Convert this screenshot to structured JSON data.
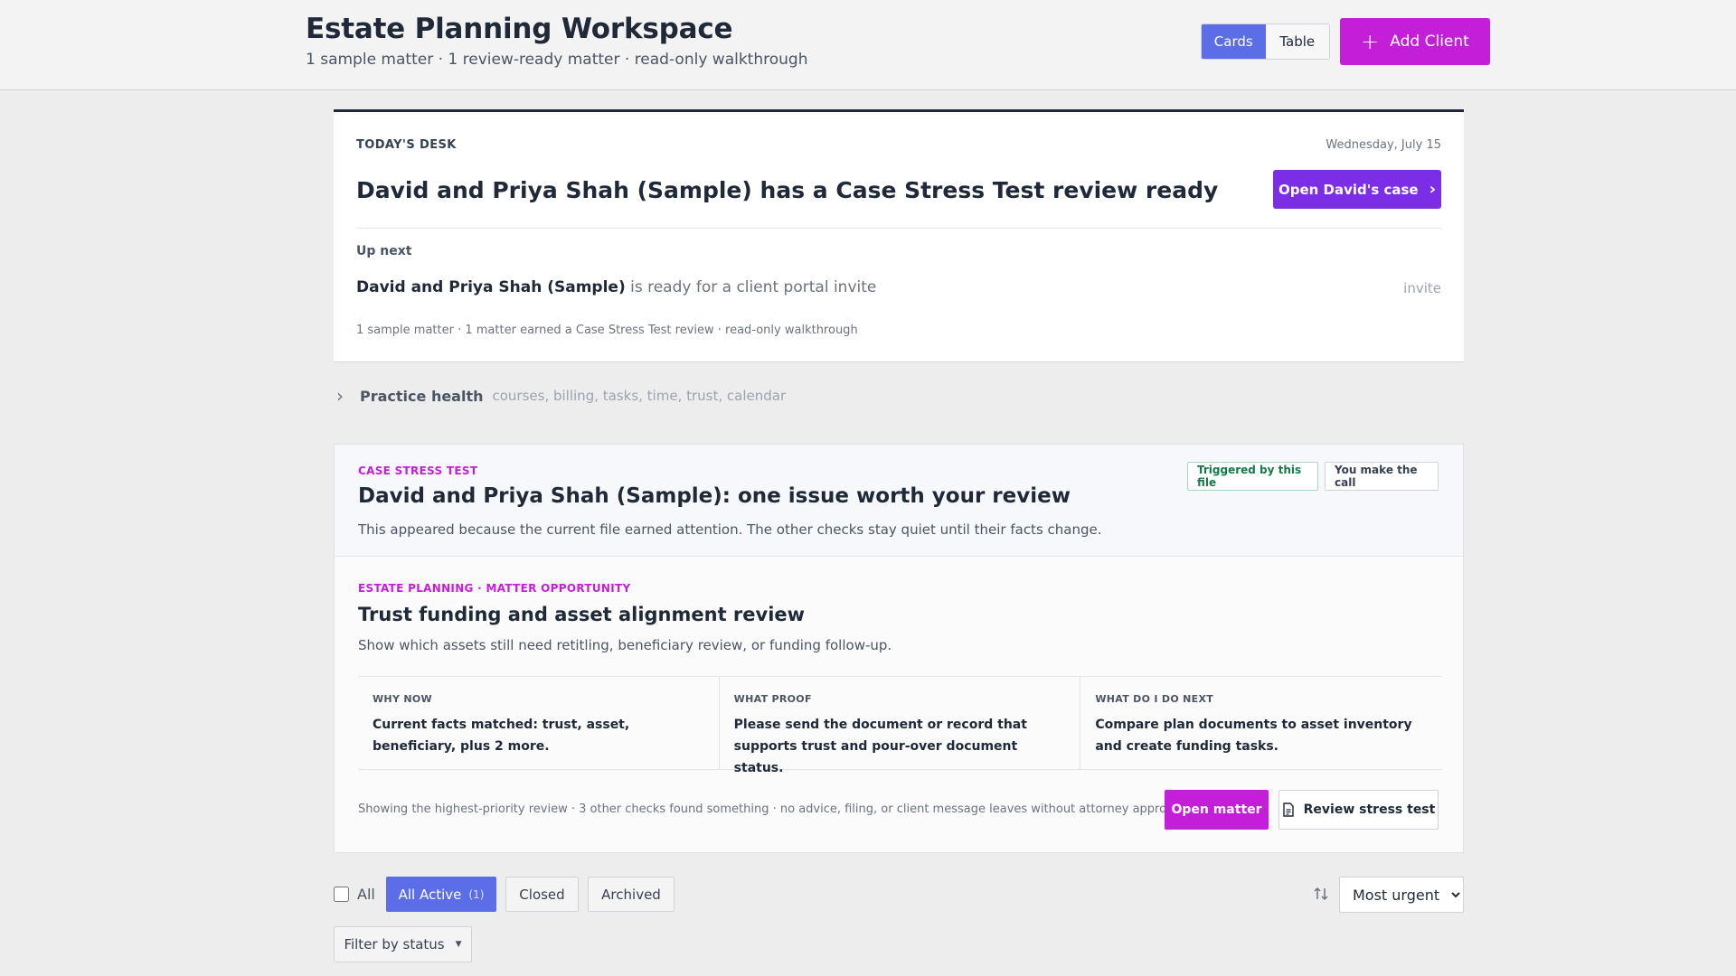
{
  "header": {
    "title": "Estate Planning Workspace",
    "subtitle": "1 sample matter · 1 review-ready matter · read-only walkthrough",
    "view_cards": "Cards",
    "view_table": "Table",
    "add_client": "Add Client"
  },
  "desk": {
    "eyebrow": "TODAY'S DESK",
    "date": "Wednesday, July 15",
    "headline": "David and Priya Shah (Sample) has a Case Stress Test review ready",
    "open_case": "Open David's case",
    "upnext_label": "Up next",
    "upnext_client": "David and Priya Shah (Sample)",
    "upnext_text": "is ready for a client portal invite",
    "upnext_tag": "invite",
    "meta": "1 sample matter · 1 matter earned a Case Stress Test review · read-only walkthrough"
  },
  "practice_health": {
    "label": "Practice health",
    "sub": "courses, billing, tasks, time, trust, calendar"
  },
  "stress_test": {
    "eyebrow": "CASE STRESS TEST",
    "title": "David and Priya Shah (Sample): one issue worth your review",
    "description": "This appeared because the current file earned attention. The other checks stay quiet until their facts change.",
    "pill_triggered": "Triggered by this file",
    "pill_call": "You make the call",
    "opportunity": {
      "eyebrow": "ESTATE PLANNING · MATTER OPPORTUNITY",
      "title": "Trust funding and asset alignment review",
      "description": "Show which assets still need retitling, beneficiary review, or funding follow-up.",
      "facts": [
        {
          "label": "WHY NOW",
          "text": "Current facts matched: trust, asset, beneficiary, plus 2 more."
        },
        {
          "label": "WHAT PROOF",
          "text": "Please send the document or record that supports trust and pour-over document status."
        },
        {
          "label": "WHAT DO I DO NEXT",
          "text": "Compare plan documents to asset inventory and create funding tasks."
        }
      ]
    },
    "footnote": "Showing the highest-priority review · 3 other checks found something · no advice, filing, or client message leaves without attorney approval.",
    "open_matter": "Open matter",
    "review_stress": "Review stress test"
  },
  "filters": {
    "select_all": "All",
    "tab_active": "All Active",
    "tab_active_count": "(1)",
    "tab_closed": "Closed",
    "tab_archived": "Archived",
    "sort_selected": "Most urgent",
    "filter_status": "Filter by status"
  },
  "colors": {
    "accent_magenta": "#c41fd8",
    "accent_purple": "#7c2ee6",
    "accent_blue": "#5b6ee8",
    "success_green": "#16794a"
  }
}
